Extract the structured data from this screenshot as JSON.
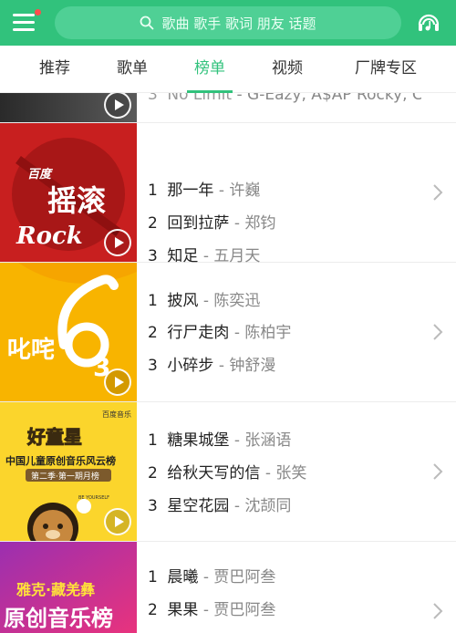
{
  "search": {
    "placeholder": "歌曲 歌手 歌词 朋友 话题"
  },
  "tabs": [
    {
      "label": "推荐",
      "active": false
    },
    {
      "label": "歌单",
      "active": false
    },
    {
      "label": "榜单",
      "active": true
    },
    {
      "label": "视频",
      "active": false
    },
    {
      "label": "厂牌专区",
      "active": false
    }
  ],
  "charts": [
    {
      "cover_text": [],
      "songs": [
        {
          "rank": "3",
          "title": "No Limit",
          "artist": "G-Eazy, A$AP Rocky, Cardi B"
        }
      ]
    },
    {
      "cover_text": [
        "百度",
        "摇滚",
        "Rock"
      ],
      "songs": [
        {
          "rank": "1",
          "title": "那一年",
          "artist": "许巍"
        },
        {
          "rank": "2",
          "title": "回到拉萨",
          "artist": "郑钧"
        },
        {
          "rank": "3",
          "title": "知足",
          "artist": "五月天"
        }
      ]
    },
    {
      "cover_text": [
        "叱咤",
        "3"
      ],
      "songs": [
        {
          "rank": "1",
          "title": "披风",
          "artist": "陈奕迅"
        },
        {
          "rank": "2",
          "title": "行尸走肉",
          "artist": "陈柏宇"
        },
        {
          "rank": "3",
          "title": "小碎步",
          "artist": "钟舒漫"
        }
      ]
    },
    {
      "cover_text": [
        "好童星",
        "中国儿童原创音乐风云榜",
        "第二季·第一期月榜",
        "BE YOURSELF",
        "百度音乐"
      ],
      "songs": [
        {
          "rank": "1",
          "title": "糖果城堡",
          "artist": "张涵语"
        },
        {
          "rank": "2",
          "title": "给秋天写的信",
          "artist": "张笑"
        },
        {
          "rank": "3",
          "title": "星空花园",
          "artist": "沈颉同"
        }
      ]
    },
    {
      "cover_text": [
        "雅克·藏羌彝",
        "原创音乐榜"
      ],
      "songs": [
        {
          "rank": "1",
          "title": "晨曦",
          "artist": "贾巴阿叁"
        },
        {
          "rank": "2",
          "title": "果果",
          "artist": "贾巴阿叁"
        }
      ]
    }
  ],
  "colors": {
    "accent": "#31c27c",
    "artist": "#888888"
  }
}
